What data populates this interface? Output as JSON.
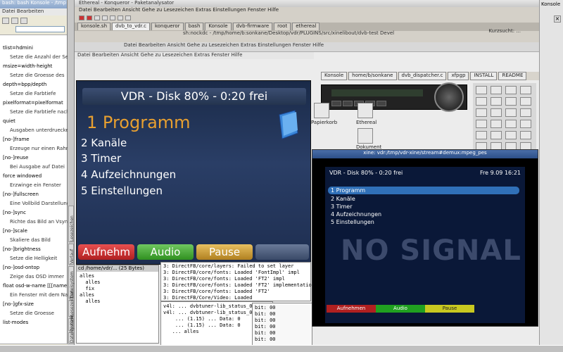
{
  "left_window": {
    "title": "bash: bash Konsole - /tmp",
    "menu": "Datei  Bearbeiten",
    "lines": [
      {
        "text": "tlist=hdmini",
        "sub": false
      },
      {
        "text": "Setze die Anzahl der Sender",
        "sub": true
      },
      {
        "text": "msize=width-height",
        "sub": false
      },
      {
        "text": "Setze die Groesse des",
        "sub": true
      },
      {
        "text": "depth=bpp/depth",
        "sub": false
      },
      {
        "text": "Setze die Farbtiefe",
        "sub": true
      },
      {
        "text": "pixelformat=pixelformat",
        "sub": false
      },
      {
        "text": "Setze die Farbtiefe nach",
        "sub": true
      },
      {
        "text": "quiet",
        "sub": false
      },
      {
        "text": "Ausgaben unterdruecken",
        "sub": true
      },
      {
        "text": "[no-]frame",
        "sub": false
      },
      {
        "text": "Erzeuge nur einen Rahmen",
        "sub": true
      },
      {
        "text": "[no-]reuse",
        "sub": false
      },
      {
        "text": "Bei Ausgabe auf Datei",
        "sub": true
      },
      {
        "text": "force windowed",
        "sub": false
      },
      {
        "text": "Erzwinge ein Fenster",
        "sub": true
      },
      {
        "text": "[no-]fullscreen",
        "sub": false
      },
      {
        "text": "Eine Vollbild Darstellung",
        "sub": true
      },
      {
        "text": "[no-]sync",
        "sub": false
      },
      {
        "text": "Richte das Bild an Vsync",
        "sub": true
      },
      {
        "text": "[no-]scale",
        "sub": false
      },
      {
        "text": "Skaliere das Bild",
        "sub": true
      },
      {
        "text": "[no-]brightness",
        "sub": false
      },
      {
        "text": "Setze die Helligkeit",
        "sub": true
      },
      {
        "text": "[no-]osd-ontop",
        "sub": false
      },
      {
        "text": "Zeige das OSD immer",
        "sub": true
      },
      {
        "text": "float osd-w-name [[[name]]]",
        "sub": false
      },
      {
        "text": "Ein Fenster mit dem Namen",
        "sub": true
      },
      {
        "text": "[no-]gfx-size",
        "sub": false
      },
      {
        "text": "Setze die Groesse",
        "sub": true
      },
      {
        "text": "list-modes",
        "sub": false
      }
    ]
  },
  "vtabs": [
    "Lesezeichen",
    "Verlauf",
    "Dateisystem",
    "Lesezeichen",
    "Notizen",
    "Dateisystem"
  ],
  "main_window": {
    "title": "Ethereal - Konqueror - Paketanalysator",
    "menu": "Datei  Bearbeiten  Ansicht  Gehe zu  Lesezeichen  Extras  Einstellungen  Fenster  Hilfe",
    "tabs": [
      "konsole.sh",
      "dvb_to_vdr.c",
      "konqueror",
      "bash",
      "Konsole",
      "dvb-firmware",
      "root",
      "ethereal"
    ],
    "path": "sh:nockdc - /tmp/home/b:sonkane/Desktop/vdr/PLUGINS/src/xinelibout/dvb-test  Devel",
    "search": "Kurzsucht: ..."
  },
  "fm": {
    "head": "Datei  Bearbeiten  Ansicht  Gehe zu  Lesezeichen  Extras  Einstellungen  Fenster  Hilfe",
    "menu2": "Datei  Bearbeiten  Ansicht  Gehe zu  Lesezeichen  Extras  Fenster  Hilfe"
  },
  "tab2": [
    "Konsole",
    "home/b/sonkane",
    "dvb_dispatcher.c",
    "xfpgp",
    "INSTALL",
    "README"
  ],
  "desktop_icons": [
    {
      "label": "Papierkorb"
    },
    {
      "label": "Ethereal"
    },
    {
      "label": "Dokument"
    }
  ],
  "vdr": {
    "header": "VDR  -  Disk 80%  -   0:20 frei",
    "selected": "1 Programm",
    "items": [
      "2 Kanäle",
      "3 Timer",
      "4 Aufzeichnungen",
      "5 Einstellungen"
    ],
    "buttons": [
      {
        "label": "Aufnehm",
        "color": "#d03030"
      },
      {
        "label": "Audio",
        "color": "#40a030"
      },
      {
        "label": "Pause",
        "color": "#c8a030"
      },
      {
        "label": "",
        "color": "#506080"
      }
    ]
  },
  "xine": {
    "title": "xine: vdr:/tmp/vdr-xine/stream#demux:mpeg_pes",
    "header_left": "VDR  -  Disk 80%  -  0:20 frei",
    "header_right": "Fre  9.09  16:21",
    "selected": "1 Programm",
    "items": [
      "2 Kanäle",
      "3 Timer",
      "4 Aufzeichnungen",
      "5 Einstellungen"
    ],
    "no_signal": "NO SIGNAL",
    "buttons": [
      {
        "label": "Aufnehmen",
        "color": "#b02020"
      },
      {
        "label": "Audio",
        "color": "#20a020"
      },
      {
        "label": "Pause",
        "color": "#c8c820"
      }
    ]
  },
  "terminal": {
    "lines": [
      "3: DirectFB/core/layers: Failed to set layer",
      "3: DirectFB/core/fonts: Loaded 'FontImpl' impl",
      "3: DirectFB/core/fonts: Loaded 'FT2' impl",
      "3: DirectFB/core/fonts: Loaded 'FT2' implementation",
      "3: DirectFB/core/fonts: Loaded 'FT2'",
      "3: DirectFB/Core/Video: Loaded",
      "3: DirectFB/Core/Video: Loaded",
      "3: DirectFB/Core/Video: Loaded"
    ]
  },
  "terminal2": {
    "title": "cd /home/vdr/... (25 Bytes)",
    "lines": [
      "alles",
      "  alles",
      "  fix",
      "alles",
      "  alles"
    ]
  },
  "terminal3": {
    "lines": [
      "v4l: ... dvbtuner-lib_status_0",
      "v4l: ... dvbtuner-lib_status_0",
      "    ... (1.15) ... Data: 0",
      "    ... (1.15) ... Data: 0",
      "   ... alles"
    ]
  },
  "terminal4": {
    "lines": [
      "bit: 00",
      "bit: 00",
      "bit: 00",
      "bit: 00",
      "bit: 00",
      "bit: 00"
    ]
  },
  "right_col": {
    "label": "Konsole"
  },
  "colors": {
    "vdr_selected": "#e8a030",
    "vdr_bg": "#1e2e50",
    "xine_bg": "#0a1838",
    "xine_selected": "#3070b8"
  }
}
